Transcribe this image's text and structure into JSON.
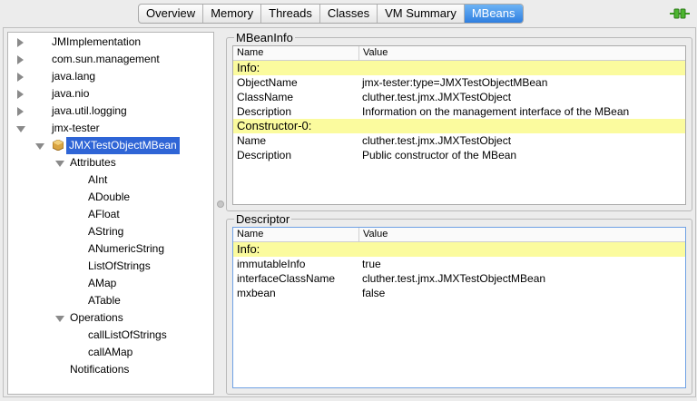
{
  "tabs": [
    {
      "label": "Overview",
      "active": false
    },
    {
      "label": "Memory",
      "active": false
    },
    {
      "label": "Threads",
      "active": false
    },
    {
      "label": "Classes",
      "active": false
    },
    {
      "label": "VM Summary",
      "active": false
    },
    {
      "label": "MBeans",
      "active": true
    }
  ],
  "connection": {
    "icon": "connected-plug-icon",
    "color": "#3a9a22"
  },
  "tree": {
    "roots": [
      "JMImplementation",
      "com.sun.management",
      "java.lang",
      "java.nio",
      "java.util.logging",
      "jmx-tester"
    ],
    "selected_bean": "JMXTestObjectMBean",
    "attributes_label": "Attributes",
    "attributes": [
      "AInt",
      "ADouble",
      "AFloat",
      "AString",
      "ANumericString",
      "ListOfStrings",
      "AMap",
      "ATable"
    ],
    "operations_label": "Operations",
    "operations": [
      "callListOfStrings",
      "callAMap"
    ],
    "notifications_label": "Notifications"
  },
  "mbeaninfo": {
    "title": "MBeanInfo",
    "col_name": "Name",
    "col_value": "Value",
    "rows": [
      {
        "name": "Info:",
        "value": "",
        "section": true
      },
      {
        "name": "ObjectName",
        "value": "jmx-tester:type=JMXTestObjectMBean",
        "section": false
      },
      {
        "name": "ClassName",
        "value": "cluther.test.jmx.JMXTestObject",
        "section": false
      },
      {
        "name": "Description",
        "value": "Information on the management interface of the MBean",
        "section": false
      },
      {
        "name": "Constructor-0:",
        "value": "",
        "section": true
      },
      {
        "name": "Name",
        "value": "cluther.test.jmx.JMXTestObject",
        "section": false
      },
      {
        "name": "Description",
        "value": "Public constructor of the MBean",
        "section": false
      }
    ]
  },
  "descriptor": {
    "title": "Descriptor",
    "col_name": "Name",
    "col_value": "Value",
    "rows": [
      {
        "name": "Info:",
        "value": "",
        "section": true
      },
      {
        "name": "immutableInfo",
        "value": "true",
        "section": false
      },
      {
        "name": "interfaceClassName",
        "value": "cluther.test.jmx.JMXTestObjectMBean",
        "section": false
      },
      {
        "name": "mxbean",
        "value": "false",
        "section": false
      }
    ]
  },
  "colors": {
    "selection": "#2f65d6",
    "section_row": "#fbfb9e",
    "active_tab": "#2f7fe0"
  }
}
